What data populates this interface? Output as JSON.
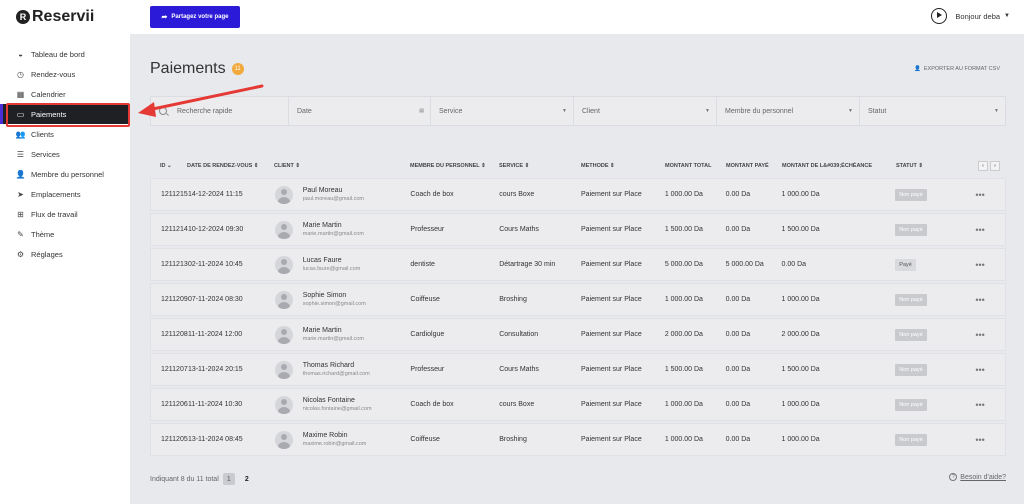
{
  "app": {
    "logo_letter": "R",
    "name": "Reservii"
  },
  "sidebar": {
    "items": [
      {
        "label": "Tableau de bord",
        "icon": "dashboard-icon"
      },
      {
        "label": "Rendez-vous",
        "icon": "clock-icon"
      },
      {
        "label": "Calendrier",
        "icon": "calendar-icon"
      },
      {
        "label": "Paiements",
        "icon": "wallet-icon"
      },
      {
        "label": "Clients",
        "icon": "users-icon"
      },
      {
        "label": "Services",
        "icon": "list-icon"
      },
      {
        "label": "Membre du personnel",
        "icon": "user-icon"
      },
      {
        "label": "Emplacements",
        "icon": "location-icon"
      },
      {
        "label": "Flux de travail",
        "icon": "workflow-icon"
      },
      {
        "label": "Thème",
        "icon": "brush-icon"
      },
      {
        "label": "Réglages",
        "icon": "gear-icon"
      }
    ],
    "active_index": 3
  },
  "topbar": {
    "share_label": "Partagez votre page",
    "user_label": "Bonjour deba"
  },
  "page": {
    "title": "Paiements",
    "count_badge": "11",
    "export_label": "EXPORTER AU FORMAT CSV"
  },
  "filters": {
    "search_placeholder": "Recherche rapide",
    "date_label": "Date",
    "service_label": "Service",
    "client_label": "Client",
    "member_label": "Membre du personnel",
    "status_label": "Statut"
  },
  "table": {
    "headers": {
      "id": "ID",
      "date": "DATE DE RENDEZ-VOUS",
      "client": "CLIENT",
      "member": "MEMBRE DU PERSONNEL",
      "service": "SERVICE",
      "method": "METHODE",
      "total": "MONTANT TOTAL",
      "paid": "MONTANT PAYÉ",
      "due": "MONTANT DE L&#039;ÉCHÉANCE",
      "status": "STATUT"
    },
    "rows": [
      {
        "id": "1211215",
        "date": "14-12-2024 11:15",
        "name": "Paul Moreau",
        "email": "paul.moreau@gmail.com",
        "member": "Coach de box",
        "service": "cours Boxe",
        "method": "Paiement sur Place",
        "total": "1 000.00 Da",
        "paid": "0.00 Da",
        "due": "1 000.00 Da",
        "status": "Non payé"
      },
      {
        "id": "1211214",
        "date": "10-12-2024 09:30",
        "name": "Marie Martin",
        "email": "marie.martin@gmail.com",
        "member": "Professeur",
        "service": "Cours Maths",
        "method": "Paiement sur Place",
        "total": "1 500.00 Da",
        "paid": "0.00 Da",
        "due": "1 500.00 Da",
        "status": "Non payé"
      },
      {
        "id": "1211213",
        "date": "02-11-2024 10:45",
        "name": "Lucas Faure",
        "email": "lucas.faure@gmail.com",
        "member": "dentiste",
        "service": "Détartrage 30 min",
        "method": "Paiement sur Place",
        "total": "5 000.00 Da",
        "paid": "5 000.00 Da",
        "due": "0.00 Da",
        "status": "Payé"
      },
      {
        "id": "1211209",
        "date": "07-11-2024 08:30",
        "name": "Sophie Simon",
        "email": "sophie.simon@gmail.com",
        "member": "Coiffeuse",
        "service": "Broshing",
        "method": "Paiement sur Place",
        "total": "1 000.00 Da",
        "paid": "0.00 Da",
        "due": "1 000.00 Da",
        "status": "Non payé"
      },
      {
        "id": "1211208",
        "date": "11-11-2024 12:00",
        "name": "Marie Martin",
        "email": "marie.martin@gmail.com",
        "member": "Cardiolgue",
        "service": "Consultation",
        "method": "Paiement sur Place",
        "total": "2 000.00 Da",
        "paid": "0.00 Da",
        "due": "2 000.00 Da",
        "status": "Non payé"
      },
      {
        "id": "1211207",
        "date": "13-11-2024 20:15",
        "name": "Thomas Richard",
        "email": "thomas.richard@gmail.com",
        "member": "Professeur",
        "service": "Cours Maths",
        "method": "Paiement sur Place",
        "total": "1 500.00 Da",
        "paid": "0.00 Da",
        "due": "1 500.00 Da",
        "status": "Non payé"
      },
      {
        "id": "1211206",
        "date": "11-11-2024 10:30",
        "name": "Nicolas Fontaine",
        "email": "nicolas.fontaine@gmail.com",
        "member": "Coach de box",
        "service": "cours Boxe",
        "method": "Paiement sur Place",
        "total": "1 000.00 Da",
        "paid": "0.00 Da",
        "due": "1 000.00 Da",
        "status": "Non payé"
      },
      {
        "id": "1211205",
        "date": "13-11-2024 08:45",
        "name": "Maxime Robin",
        "email": "maxime.robin@gmail.com",
        "member": "Coiffeuse",
        "service": "Broshing",
        "method": "Paiement sur Place",
        "total": "1 000.00 Da",
        "paid": "0.00 Da",
        "due": "1 000.00 Da",
        "status": "Non payé"
      }
    ]
  },
  "footer": {
    "summary": "Indiquant 8 du 11 total",
    "page_current": "1",
    "page_next": "2",
    "help_label": "Besoin d'aide?"
  },
  "colors": {
    "accent": "#2b1bd8",
    "active_nav": "#1f2023",
    "annotation": "#e53935",
    "badge": "#f2a93b"
  }
}
